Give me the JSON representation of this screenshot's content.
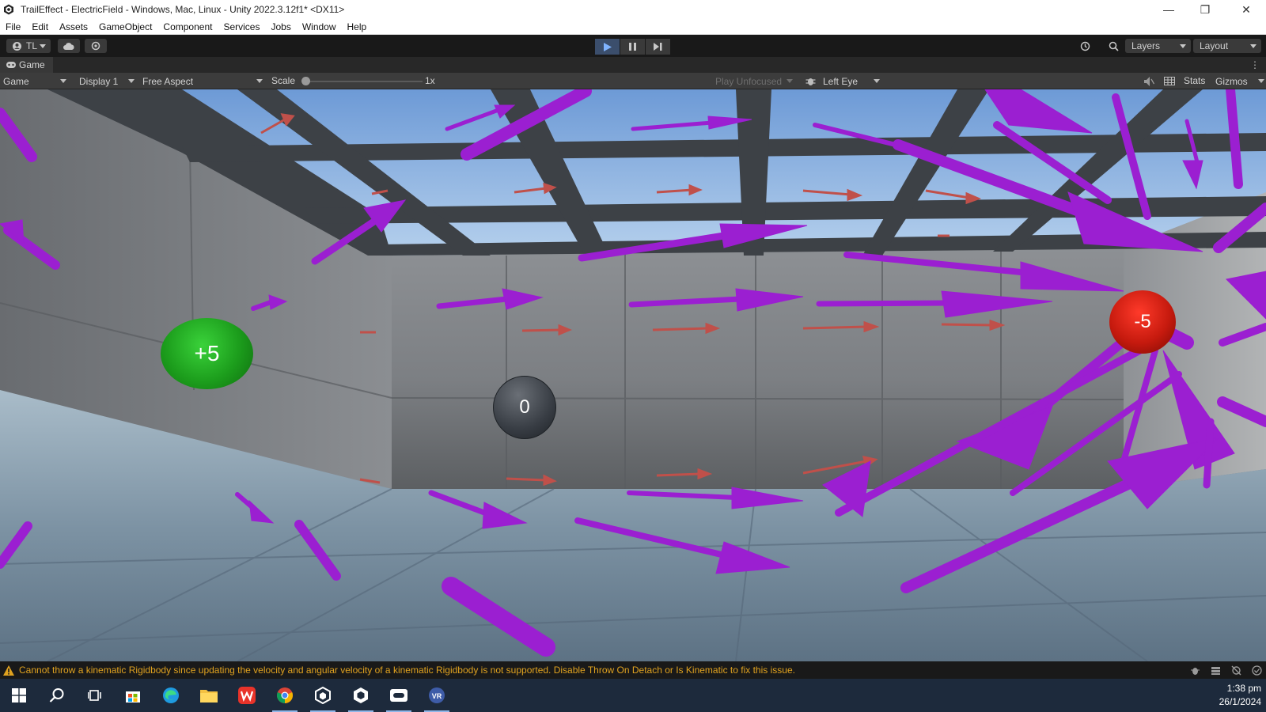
{
  "window": {
    "title": "TrailEffect - ElectricField - Windows, Mac, Linux - Unity 2022.3.12f1* <DX11>",
    "controls": {
      "minimize": "—",
      "restore": "❐",
      "close": "✕"
    }
  },
  "menubar": {
    "items": [
      "File",
      "Edit",
      "Assets",
      "GameObject",
      "Component",
      "Services",
      "Jobs",
      "Window",
      "Help"
    ]
  },
  "toolbar": {
    "account_label": "TL",
    "layers_label": "Layers",
    "layout_label": "Layout",
    "play_active": true
  },
  "game_tab": {
    "label": "Game"
  },
  "game_toolbar": {
    "view_mode": "Game",
    "display": "Display 1",
    "aspect": "Free Aspect",
    "scale_label": "Scale",
    "scale_value": "1x",
    "scale_fraction": 0.0,
    "play_focus": "Play Unfocused",
    "eye": "Left Eye",
    "stats_label": "Stats",
    "gizmos_label": "Gizmos"
  },
  "scene": {
    "charges": {
      "positive": "+5",
      "neutral": "0",
      "negative": "-5"
    },
    "colors": {
      "field_arrow": "#9b1fd1",
      "small_arrow": "#c0504a",
      "positive_charge": "#1c9d1c",
      "negative_charge": "#c61a0e",
      "neutral_charge": "#383d44"
    }
  },
  "console": {
    "message": "Cannot throw a kinematic Rigidbody since updating the velocity and angular velocity of a kinematic Rigidbody is not supported. Disable Throw On Detach or Is Kinematic to fix this issue.",
    "warn_color": "#e0a21f"
  },
  "taskbar": {
    "apps": [
      "start-icon",
      "search-icon",
      "task-view-icon",
      "store-icon",
      "edge-icon",
      "file-explorer-icon",
      "wps-office-icon",
      "chrome-icon",
      "unity-hub-icon",
      "unity-editor-icon",
      "oculus-icon",
      "vr-app-icon"
    ],
    "time": "1:38 pm",
    "date": "26/1/2024"
  }
}
